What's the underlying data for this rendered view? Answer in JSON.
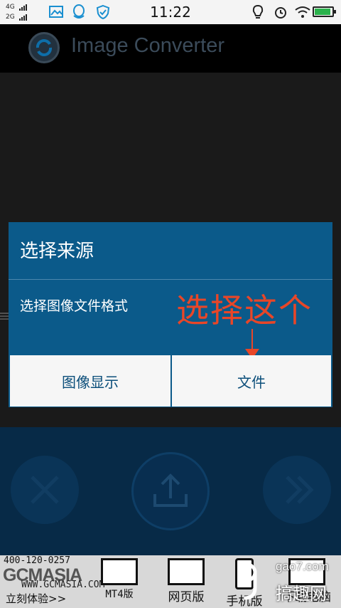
{
  "status_bar": {
    "network_top": "4G",
    "network_bottom": "2G",
    "time": "11:22",
    "battery_level": 0.92,
    "icons": [
      "image-icon",
      "qq-icon",
      "shield-icon",
      "bulb-icon",
      "alarm-icon",
      "wifi-icon",
      "battery-icon"
    ]
  },
  "app": {
    "title": "Image Converter",
    "logo_icon": "refresh-icon"
  },
  "dialog": {
    "title": "选择来源",
    "message": "选择图像文件格式",
    "annotation": "选择这个",
    "buttons": [
      "图像显示",
      "文件"
    ]
  },
  "bottom_controls": {
    "icons": [
      "close-icon",
      "upload-icon",
      "next-icon"
    ]
  },
  "ad": {
    "phone": "400-120-0257",
    "brand": "GCMASIA",
    "url": "WWW.GCMASIA.COM",
    "cta": "立刻体验>>",
    "items": [
      "MT4版",
      "网页版",
      "手机版",
      "下载电脑版"
    ]
  },
  "watermark": {
    "site": "gao7.com",
    "name": "搞趣网"
  },
  "colors": {
    "dialog_bg": "#0b5a8a",
    "button_text": "#0b4e7a",
    "annotation": "#e84628",
    "bottom_panel": "#072a47"
  }
}
